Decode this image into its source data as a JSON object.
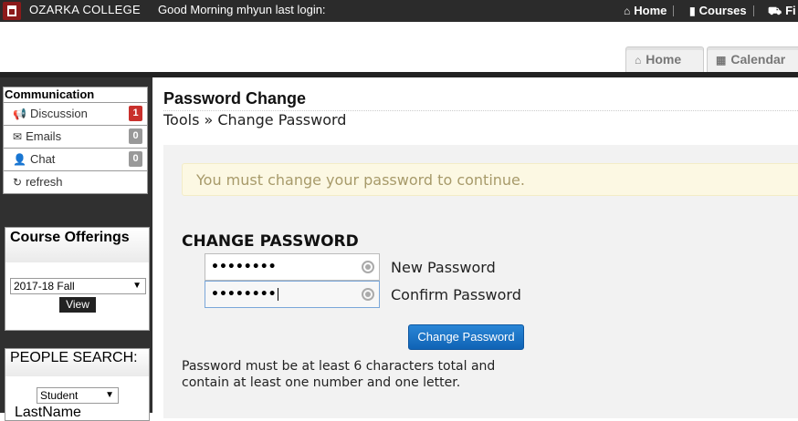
{
  "topbar": {
    "college_name": "OZARKA COLLEGE",
    "greeting": "Good Morning mhyun last login:",
    "nav": [
      {
        "label": "Home",
        "icon": "home-icon"
      },
      {
        "label": "Courses",
        "icon": "book-icon"
      },
      {
        "label": "Fi",
        "icon": "cart-icon"
      }
    ]
  },
  "tabs": [
    {
      "label": "Home",
      "icon": "home-icon"
    },
    {
      "label": "Calendar",
      "icon": "calendar-icon"
    }
  ],
  "sidebar": {
    "communication": {
      "title": "Communication",
      "items": [
        {
          "label": "Discussion",
          "icon": "megaphone-icon",
          "count": "1",
          "badge_color": "#c9302c"
        },
        {
          "label": "Emails",
          "icon": "envelope-icon",
          "count": "0",
          "badge_color": "#999999"
        },
        {
          "label": "Chat",
          "icon": "user-icon",
          "count": "0",
          "badge_color": "#999999"
        },
        {
          "label": "refresh",
          "icon": "refresh-icon"
        }
      ]
    },
    "course_offerings": {
      "title": "Course Offerings",
      "selected_term": "2017-18 Fall",
      "view_label": "View"
    },
    "people_search": {
      "title": "PEOPLE SEARCH:",
      "selected_type": "Student",
      "lastname_label": "LastName"
    }
  },
  "main": {
    "title": "Password Change",
    "breadcrumb": "Tools » Change Password",
    "alert": "You must change your password to continue.",
    "form": {
      "heading": "CHANGE PASSWORD",
      "new_password_value": "••••••••",
      "new_password_label": "New Password",
      "confirm_password_value": "••••••••",
      "confirm_password_label": "Confirm Password",
      "submit_label": "Change Password",
      "note": "Password must be at least 6 characters total and contain at least one number and one letter."
    }
  }
}
